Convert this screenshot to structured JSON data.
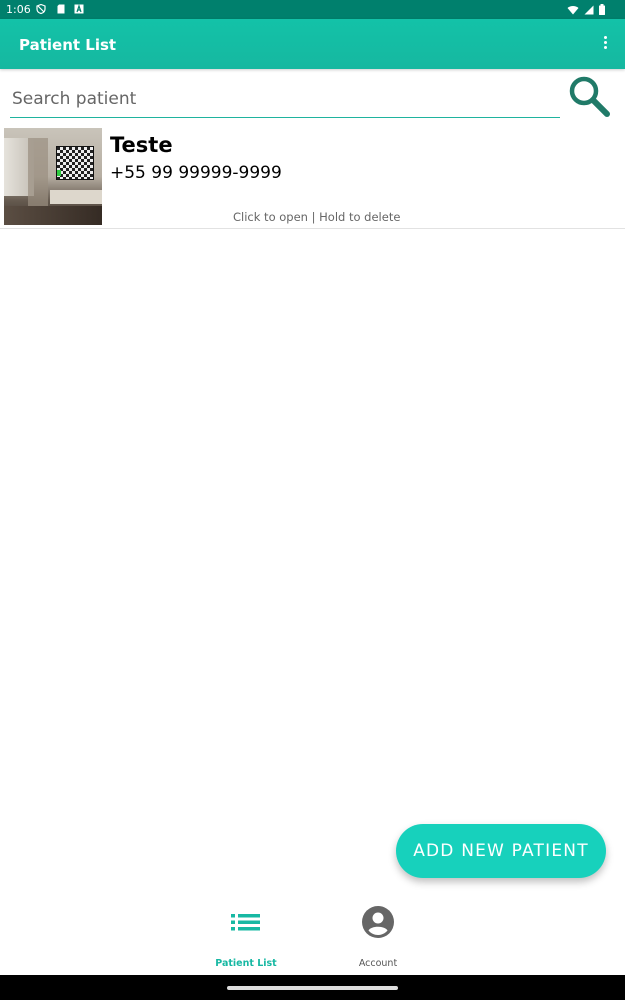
{
  "status_bar": {
    "time": "1:06",
    "left_icons": [
      "vpn-shield-icon",
      "sd-card-icon",
      "notification-a-icon"
    ],
    "right_icons": [
      "wifi-icon",
      "cell-signal-icon",
      "battery-icon"
    ]
  },
  "app_bar": {
    "title": "Patient List",
    "overflow_icon": "more-vert-icon"
  },
  "search": {
    "placeholder": "Search patient",
    "value": "",
    "icon": "search-icon"
  },
  "patients": [
    {
      "name": "Teste",
      "phone": "+55 99 99999-9999",
      "hint": "Click to open | Hold to delete",
      "photo": "room-photo"
    }
  ],
  "fab": {
    "label": "ADD NEW PATIENT"
  },
  "bottom_nav": {
    "items": [
      {
        "label": "Patient List",
        "icon": "list-icon",
        "active": true
      },
      {
        "label": "Account",
        "icon": "account-circle-icon",
        "active": false
      }
    ]
  },
  "colors": {
    "primary": "#16b8a0",
    "status_bar": "#00806d",
    "accent": "#17d1bc",
    "search_icon": "#207a68"
  }
}
